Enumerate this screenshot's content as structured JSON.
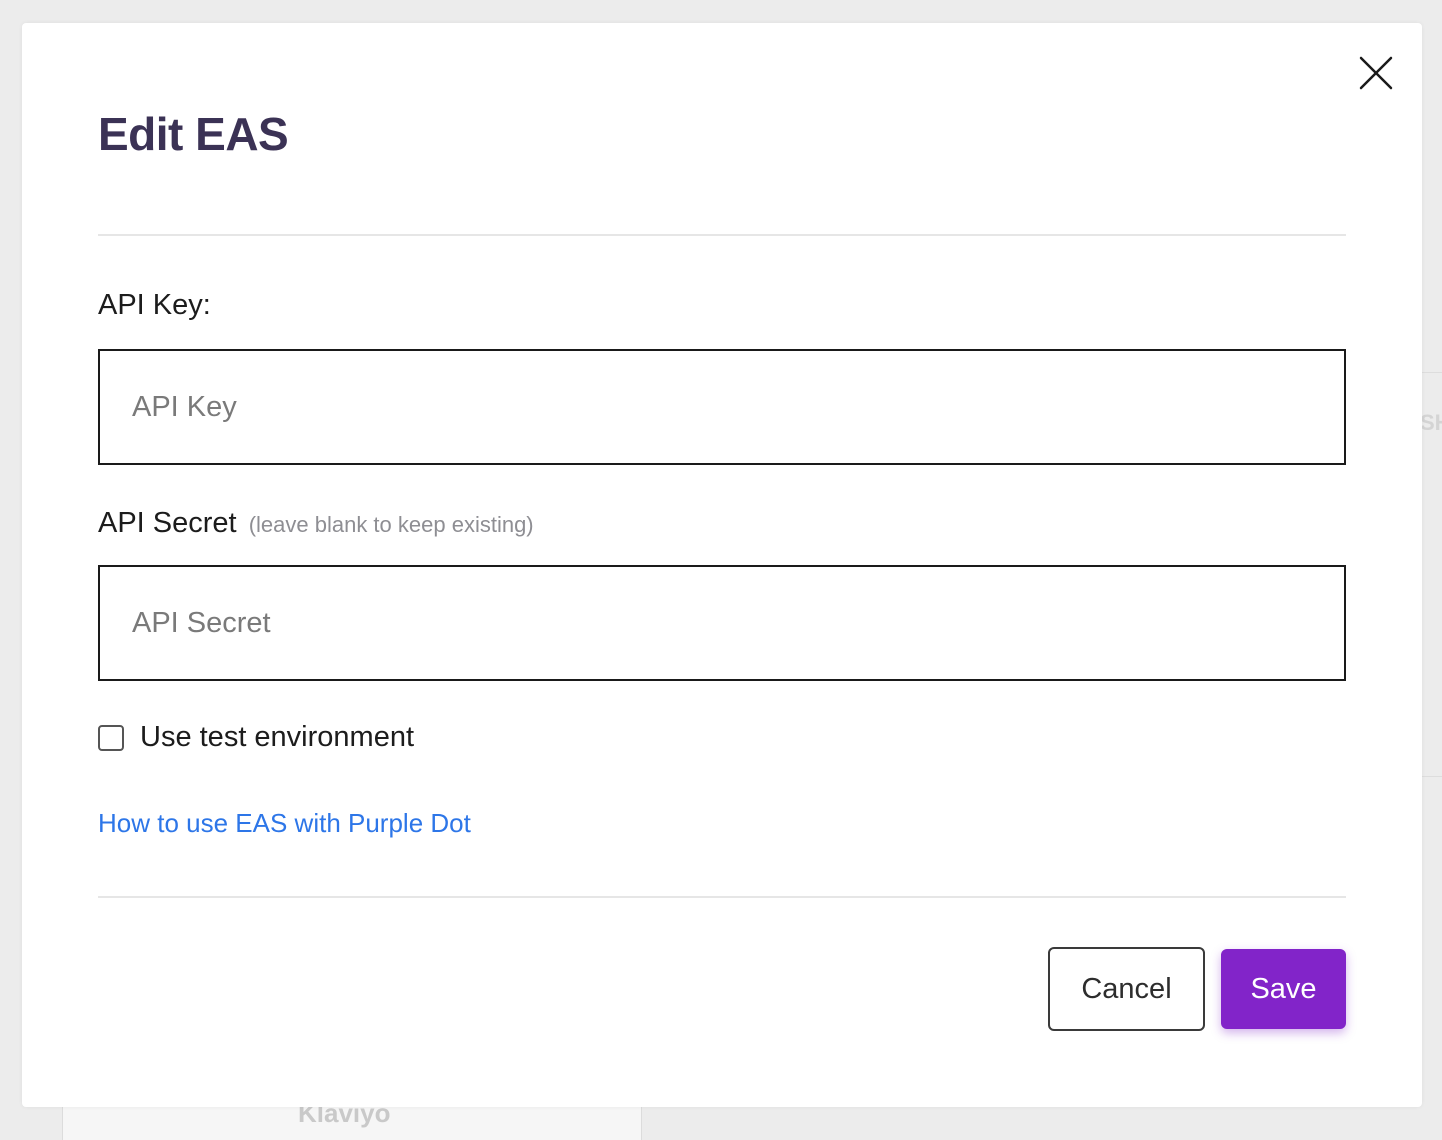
{
  "background": {
    "card_label": "Klaviyo",
    "edge_text": "SH"
  },
  "modal": {
    "title": "Edit EAS",
    "close_icon": "close-icon",
    "api_key": {
      "label": "API Key:",
      "placeholder": "API Key",
      "value": ""
    },
    "api_secret": {
      "label": "API Secret",
      "hint": "(leave blank to keep existing)",
      "placeholder": "API Secret",
      "value": ""
    },
    "test_env": {
      "label": "Use test environment",
      "checked": false
    },
    "help_link": "How to use EAS with Purple Dot",
    "buttons": {
      "cancel": "Cancel",
      "save": "Save"
    }
  },
  "colors": {
    "title": "#3b3255",
    "link": "#2d76e8",
    "primary": "#8224c9",
    "backdrop": "#ececec"
  }
}
